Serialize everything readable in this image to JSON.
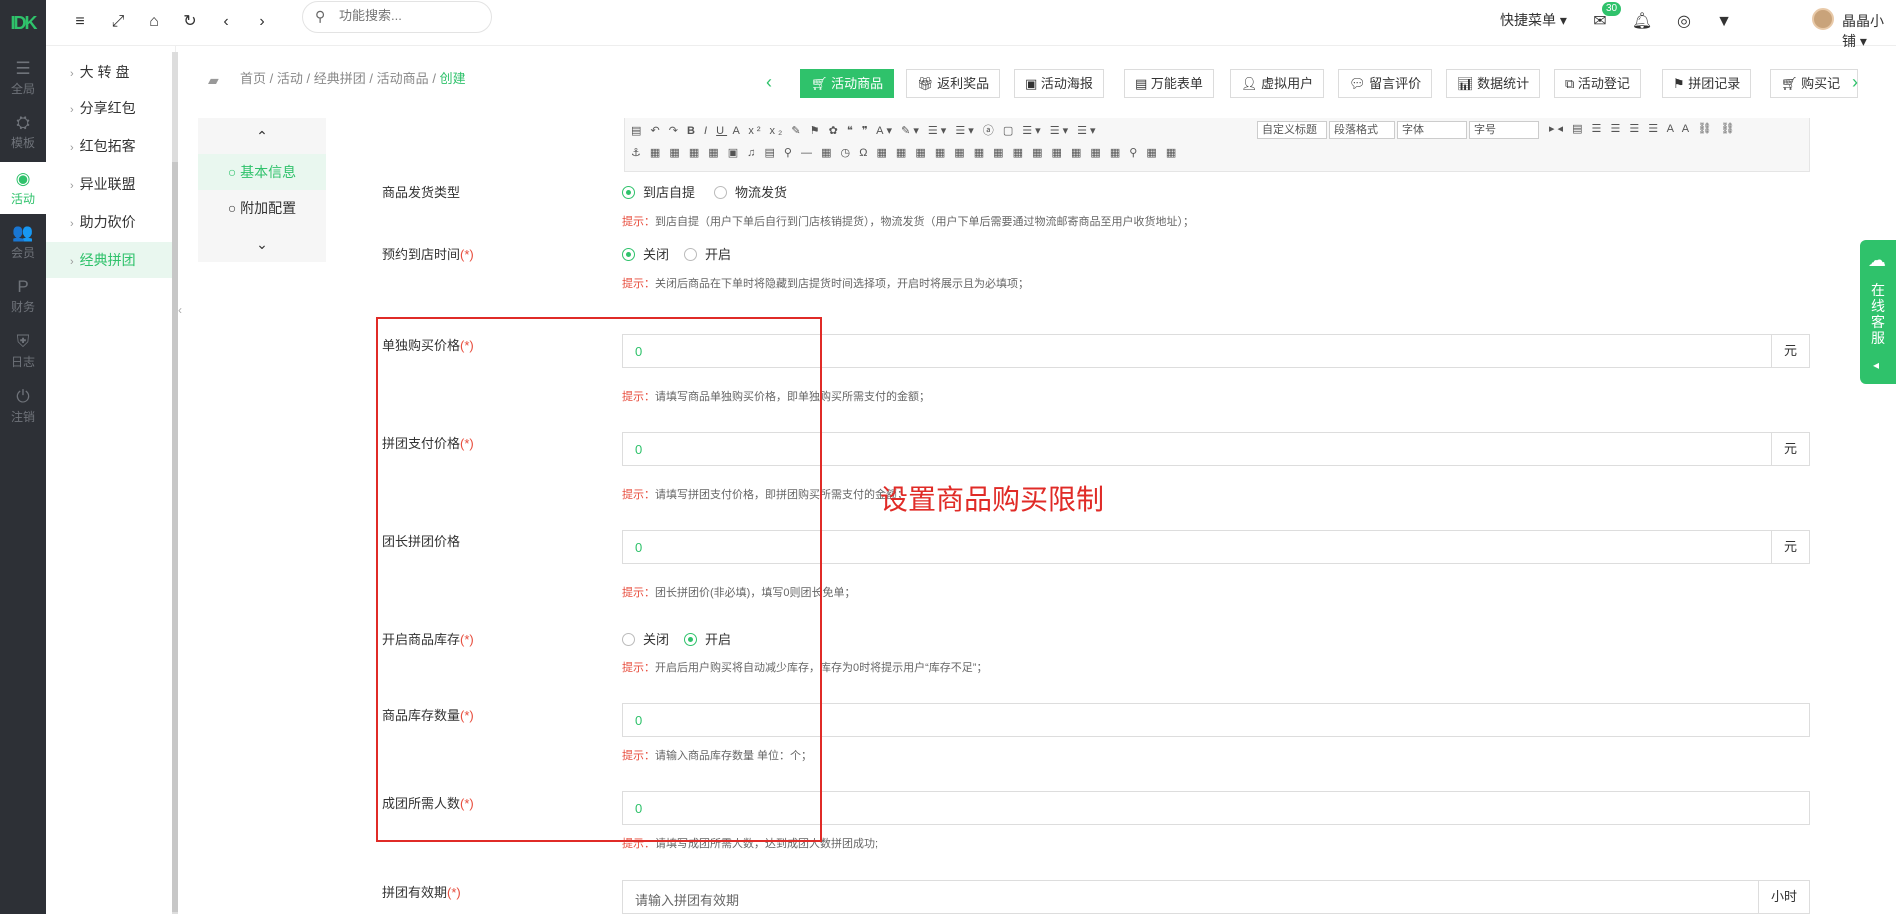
{
  "rail": {
    "logo": "IDK",
    "items": [
      {
        "label": "全局",
        "icon": "sliders-icon"
      },
      {
        "label": "模板",
        "icon": "sitemap-icon"
      },
      {
        "label": "活动",
        "icon": "podcast-icon"
      },
      {
        "label": "会员",
        "icon": "users-icon"
      },
      {
        "label": "财务",
        "icon": "paypal-icon"
      },
      {
        "label": "日志",
        "icon": "shield-icon"
      },
      {
        "label": "注销",
        "icon": "power-icon"
      }
    ]
  },
  "submenu": {
    "items": [
      {
        "label": "大 转 盘"
      },
      {
        "label": "分享红包"
      },
      {
        "label": "红包拓客"
      },
      {
        "label": "异业联盟"
      },
      {
        "label": "助力砍价"
      },
      {
        "label": "经典拼团"
      }
    ]
  },
  "topbar": {
    "search_placeholder": "功能搜索...",
    "quick_menu": "快捷菜单",
    "mail_badge": "30",
    "username": "晶晶小铺"
  },
  "breadcrumb": {
    "items": [
      "首页",
      "活动",
      "经典拼团",
      "活动商品"
    ],
    "sep": "/",
    "current": "创建"
  },
  "action_tabs": [
    {
      "label": "活动商品",
      "icon": "cart-icon"
    },
    {
      "label": "返利奖品",
      "icon": "gift-icon"
    },
    {
      "label": "活动海报",
      "icon": "image-icon"
    },
    {
      "label": "万能表单",
      "icon": "file-icon"
    },
    {
      "label": "虚拟用户",
      "icon": "user-plus-icon"
    },
    {
      "label": "留言评价",
      "icon": "comment-icon"
    },
    {
      "label": "数据统计",
      "icon": "bar-chart-icon"
    },
    {
      "label": "活动登记",
      "icon": "copy-icon"
    },
    {
      "label": "拼团记录",
      "icon": "flag-icon"
    },
    {
      "label": "购买记",
      "icon": "cart-icon"
    }
  ],
  "section_nav": {
    "items": [
      {
        "label": "基本信息"
      },
      {
        "label": "附加配置"
      }
    ]
  },
  "editor": {
    "font_label": "自定义标题",
    "para_label": "段落格式",
    "family_label": "字体",
    "size_label": "字号"
  },
  "form": {
    "hint_prefix": "提示：",
    "delivery": {
      "label": "商品发货类型",
      "options": [
        "到店自提",
        "物流发货"
      ],
      "hint": "到店自提（用户下单后自行到门店核销提货），物流发货（用户下单后需要通过物流邮寄商品至用户收货地址）；"
    },
    "appointment": {
      "label": "预约到店时间",
      "req": "(*)",
      "options": [
        "关闭",
        "开启"
      ],
      "hint": "关闭后商品在下单时将隐藏到店提货时间选择项，开启时将展示且为必填项；"
    },
    "single_price": {
      "label": "单独购买价格",
      "req": "(*)",
      "value": "0",
      "unit": "元",
      "hint": "请填写商品单独购买价格，即单独购买所需支付的金额；"
    },
    "group_price": {
      "label": "拼团支付价格",
      "req": "(*)",
      "value": "0",
      "unit": "元",
      "hint": "请填写拼团支付价格，即拼团购买所需支付的金额；"
    },
    "leader_price": {
      "label": "团长拼团价格",
      "value": "0",
      "unit": "元",
      "hint": "团长拼团价(非必填)，填写0则团长免单；"
    },
    "stock_enable": {
      "label": "开启商品库存",
      "req": "(*)",
      "options": [
        "关闭",
        "开启"
      ],
      "hint": "开启后用户购买将自动减少库存，库存为0时将提示用户“库存不足”；"
    },
    "stock_qty": {
      "label": "商品库存数量",
      "req": "(*)",
      "value": "0",
      "hint": "请输入商品库存数量 单位：个；"
    },
    "group_size": {
      "label": "成团所需人数",
      "req": "(*)",
      "value": "0",
      "hint": "请填写成团所需人数，达到成团人数拼团成功;"
    },
    "validity": {
      "label": "拼团有效期",
      "req": "(*)",
      "placeholder": "请输入拼团有效期",
      "unit": "小时"
    }
  },
  "annotation": {
    "text": "设置商品购买限制"
  },
  "kefu": {
    "label": "在线客服"
  }
}
